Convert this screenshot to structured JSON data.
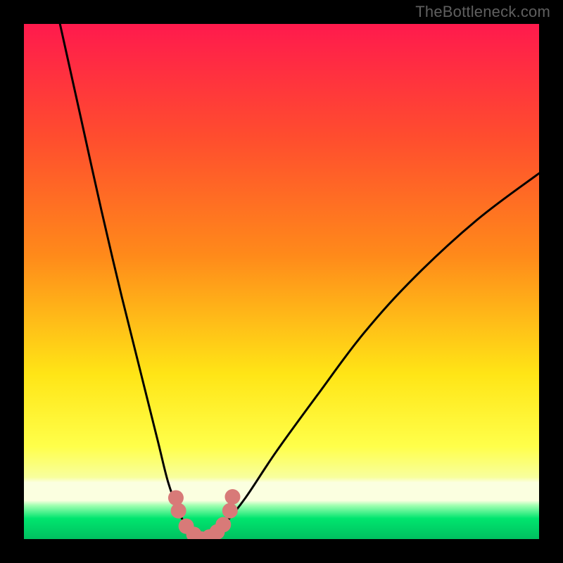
{
  "watermark": "TheBottleneck.com",
  "chart_data": {
    "type": "line",
    "title": "",
    "xlabel": "",
    "ylabel": "",
    "xlim": [
      0,
      100
    ],
    "ylim": [
      0,
      100
    ],
    "background_gradient": {
      "top": "#ff1a4d",
      "mid_upper": "#ff8a1a",
      "mid": "#ffe516",
      "mid_lower": "#f8ff9e",
      "green_band": "#00e56e",
      "bottom": "#00c060"
    },
    "series": [
      {
        "name": "left-branch",
        "x": [
          7,
          11,
          15,
          19,
          23,
          26,
          28,
          30,
          31.5,
          33,
          34.5
        ],
        "y": [
          100,
          82,
          64,
          47,
          31,
          19,
          11,
          5.5,
          2.5,
          0.8,
          0
        ]
      },
      {
        "name": "right-branch",
        "x": [
          34.5,
          36.5,
          39,
          43,
          49,
          57,
          66,
          76,
          88,
          100
        ],
        "y": [
          0,
          0.8,
          3,
          8,
          17,
          28,
          40,
          51,
          62,
          71
        ]
      }
    ],
    "markers": {
      "name": "valley-points",
      "color": "#d87a78",
      "radius_px": 11,
      "x": [
        29.5,
        30,
        31.5,
        33,
        34.5,
        36,
        37.5,
        38.7,
        40,
        40.5
      ],
      "y": [
        8,
        5.5,
        2.5,
        0.9,
        0,
        0.4,
        1.4,
        2.8,
        5.5,
        8.2
      ]
    }
  }
}
